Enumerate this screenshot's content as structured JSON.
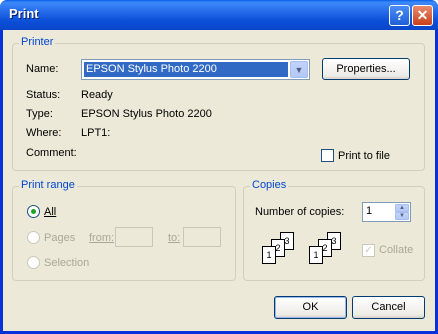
{
  "window": {
    "title": "Print"
  },
  "printer": {
    "group_label": "Printer",
    "name_label": "Name:",
    "name_value": "EPSON Stylus Photo 2200",
    "properties_label": "Properties...",
    "status_label": "Status:",
    "status_value": "Ready",
    "type_label": "Type:",
    "type_value": "EPSON Stylus Photo 2200",
    "where_label": "Where:",
    "where_value": "LPT1:",
    "comment_label": "Comment:",
    "print_to_file_label": "Print to file"
  },
  "range": {
    "group_label": "Print range",
    "all_label": "All",
    "pages_label": "Pages",
    "from_label": "from:",
    "to_label": "to:",
    "selection_label": "Selection"
  },
  "copies": {
    "group_label": "Copies",
    "number_label": "Number of copies:",
    "number_value": "1",
    "collate_label": "Collate",
    "page_numbers": [
      "1",
      "2",
      "3"
    ]
  },
  "buttons": {
    "ok": "OK",
    "cancel": "Cancel"
  }
}
